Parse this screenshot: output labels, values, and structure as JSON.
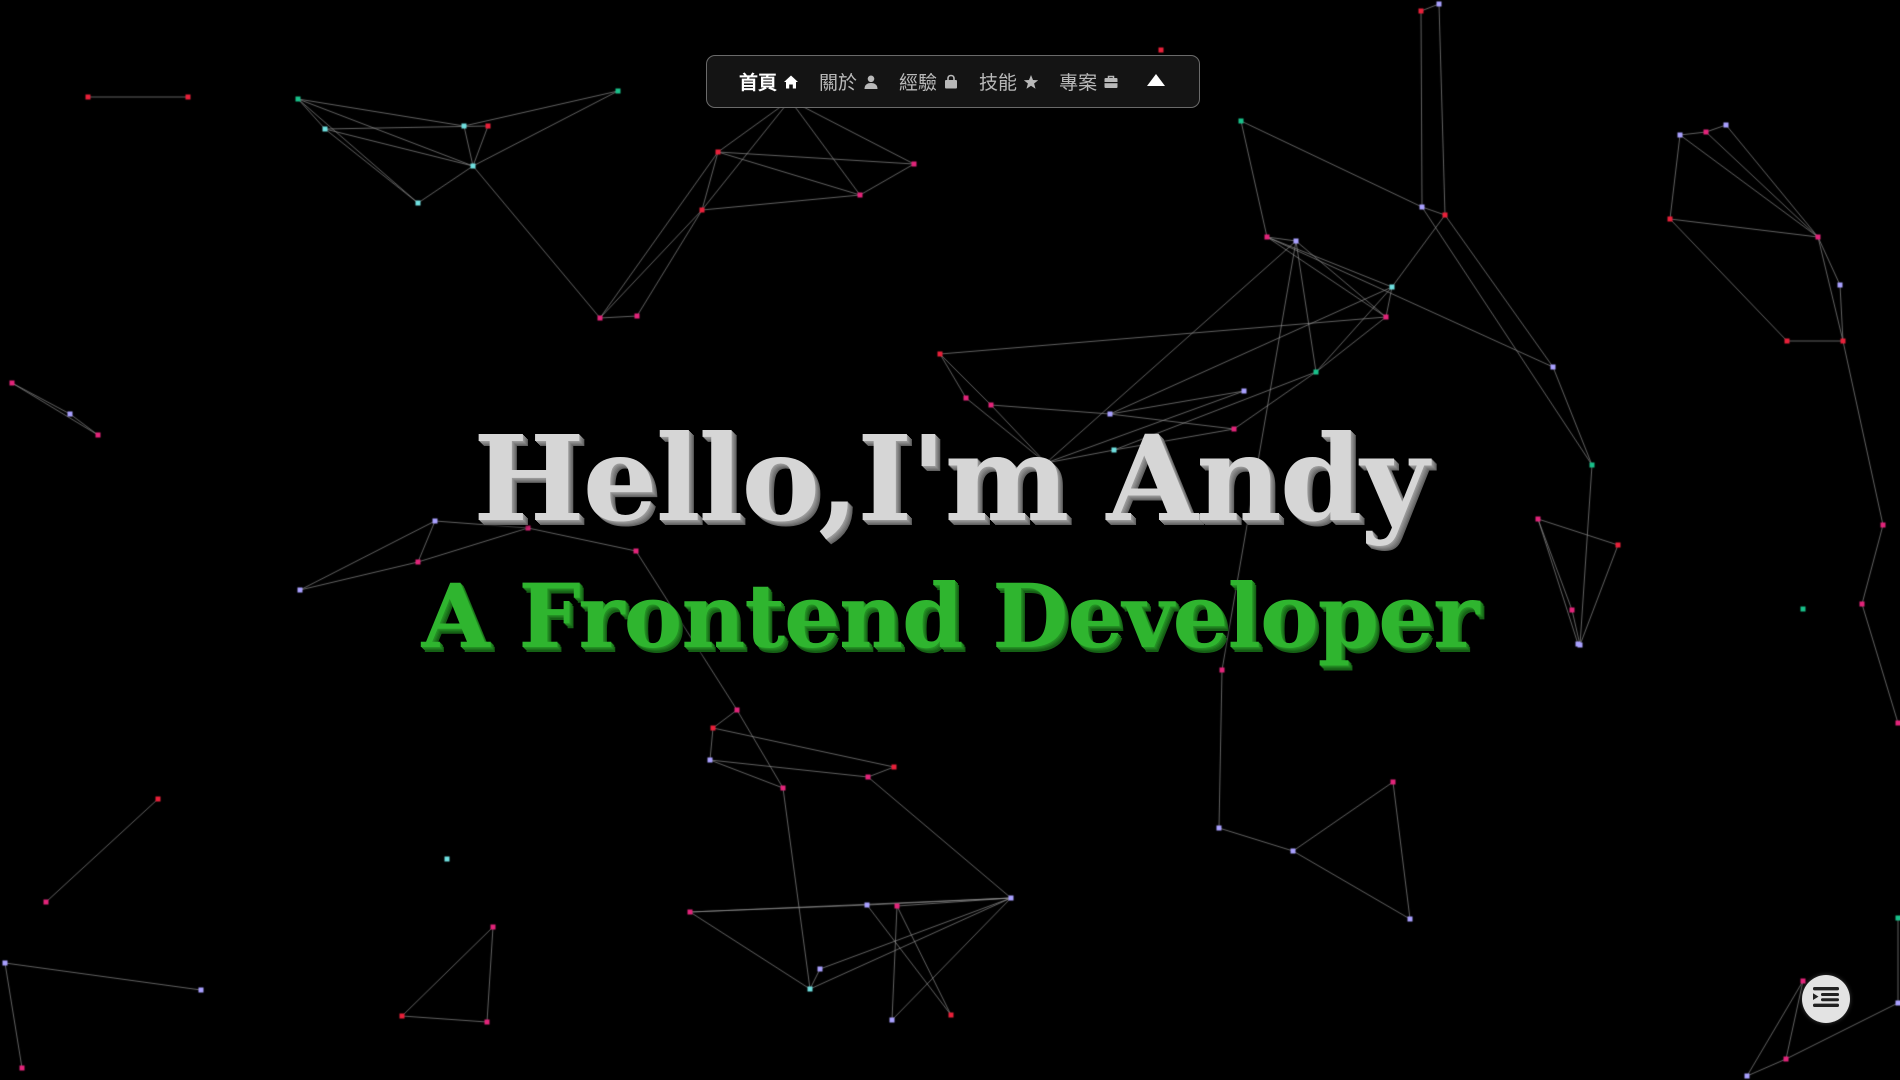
{
  "colors": {
    "background": "#000000",
    "nav_background": "#141414",
    "nav_border": "#6a6a6a",
    "nav_text": "#b9b9b9",
    "nav_text_active": "#ffffff",
    "title_text": "#d6d6d6",
    "subtitle_text": "#2fb52f",
    "particle_pink": "#e2247a",
    "particle_red": "#e8203a",
    "particle_cyan": "#6fe0e0",
    "particle_lavender": "#a9a0ff",
    "particle_teal": "#19c08a",
    "link_line": "#8a8a8a"
  },
  "nav": {
    "items": [
      {
        "label": "首頁",
        "icon": "home-icon",
        "active": true
      },
      {
        "label": "關於",
        "icon": "user-icon",
        "active": false
      },
      {
        "label": "經驗",
        "icon": "bag-icon",
        "active": false
      },
      {
        "label": "技能",
        "icon": "star-icon",
        "active": false
      },
      {
        "label": "專案",
        "icon": "briefcase-icon",
        "active": false
      }
    ],
    "collapse_icon": "caret-up-icon"
  },
  "hero": {
    "title": "Hello,I'm Andy",
    "subtitle": "A Frontend Developer"
  },
  "fab": {
    "icon": "menu-list-icon"
  }
}
